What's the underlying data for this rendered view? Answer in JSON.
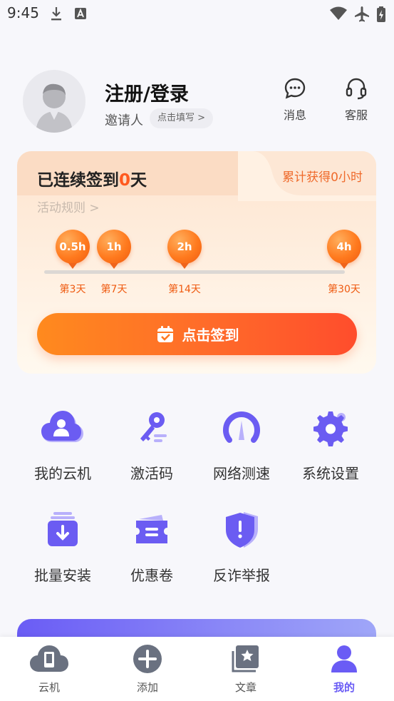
{
  "status_bar": {
    "time": "9:45",
    "icons": [
      "download-icon",
      "a-icon",
      "wifi-icon",
      "airplane-icon",
      "battery-icon"
    ]
  },
  "profile": {
    "title": "注册/登录",
    "invite_label": "邀请人",
    "invite_action": "点击填写 >",
    "messages_label": "消息",
    "service_label": "客服"
  },
  "checkin": {
    "streak_prefix": "已连续签到",
    "streak_days": "0",
    "streak_suffix": "天",
    "total": "累计获得0小时",
    "rules": "活动规则 >",
    "milestones": [
      {
        "reward": "0.5h",
        "day": "第3天"
      },
      {
        "reward": "1h",
        "day": "第7天"
      },
      {
        "reward": "2h",
        "day": "第14天"
      },
      {
        "reward": "4h",
        "day": "第30天"
      }
    ],
    "button_label": "点击签到"
  },
  "grid": [
    {
      "label": "我的云机",
      "icon": "cloud-user-icon"
    },
    {
      "label": "激活码",
      "icon": "key-icon"
    },
    {
      "label": "网络测速",
      "icon": "speedometer-icon"
    },
    {
      "label": "系统设置",
      "icon": "gear-icon"
    },
    {
      "label": "批量安装",
      "icon": "batch-install-icon"
    },
    {
      "label": "优惠卷",
      "icon": "ticket-icon"
    },
    {
      "label": "反诈举报",
      "icon": "shield-alert-icon"
    }
  ],
  "bottom_nav": [
    {
      "label": "云机",
      "icon": "cloud-phone-icon",
      "active": false
    },
    {
      "label": "添加",
      "icon": "add-icon",
      "active": false
    },
    {
      "label": "文章",
      "icon": "article-icon",
      "active": false
    },
    {
      "label": "我的",
      "icon": "profile-icon",
      "active": true
    }
  ],
  "colors": {
    "accent": "#6a5cf5",
    "orange": "#ff6a2a",
    "icon_purple": "#6b5cf2"
  }
}
